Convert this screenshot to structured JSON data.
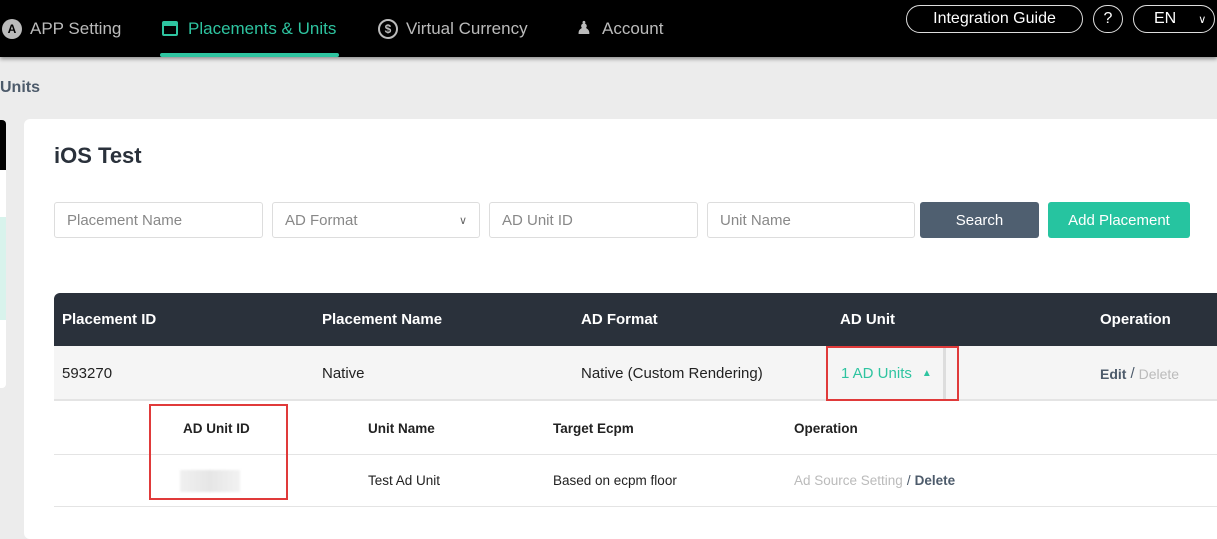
{
  "nav": {
    "items": [
      {
        "label": "APP Setting",
        "icon": "app-store-icon"
      },
      {
        "label": "Placements & Units",
        "icon": "window-icon",
        "active": true
      },
      {
        "label": "Virtual Currency",
        "icon": "coin-icon"
      },
      {
        "label": "Account",
        "icon": "user-icon"
      }
    ],
    "integration_guide": "Integration Guide",
    "help": "?",
    "language": "EN"
  },
  "breadcrumb": "Units",
  "page_title": "iOS Test",
  "filters": {
    "placement_name_placeholder": "Placement Name",
    "ad_format_value": "AD Format",
    "ad_unit_id_placeholder": "AD Unit ID",
    "unit_name_placeholder": "Unit Name",
    "search_label": "Search",
    "add_label": "Add Placement"
  },
  "table": {
    "columns": [
      "Placement ID",
      "Placement Name",
      "AD Format",
      "AD Unit",
      "Operation"
    ],
    "rows": [
      {
        "id": "593270",
        "name": "Native",
        "format": "Native (Custom Rendering)",
        "ad_unit": "1 AD Units",
        "edit": "Edit",
        "sep": "/",
        "delete": "Delete"
      }
    ]
  },
  "subtable": {
    "columns": [
      "AD Unit ID",
      "Unit Name",
      "Target Ecpm",
      "Operation"
    ],
    "rows": [
      {
        "unit_name": "Test Ad Unit",
        "target_ecpm": "Based on ecpm floor",
        "ad_source": "Ad Source Setting",
        "sep": "/",
        "delete": "Delete"
      }
    ]
  },
  "colors": {
    "accent": "#2ec4a0",
    "nav_bg": "#000000",
    "table_header": "#2a313b",
    "search_button": "#4f5f70",
    "highlight": "#e03a3a"
  }
}
